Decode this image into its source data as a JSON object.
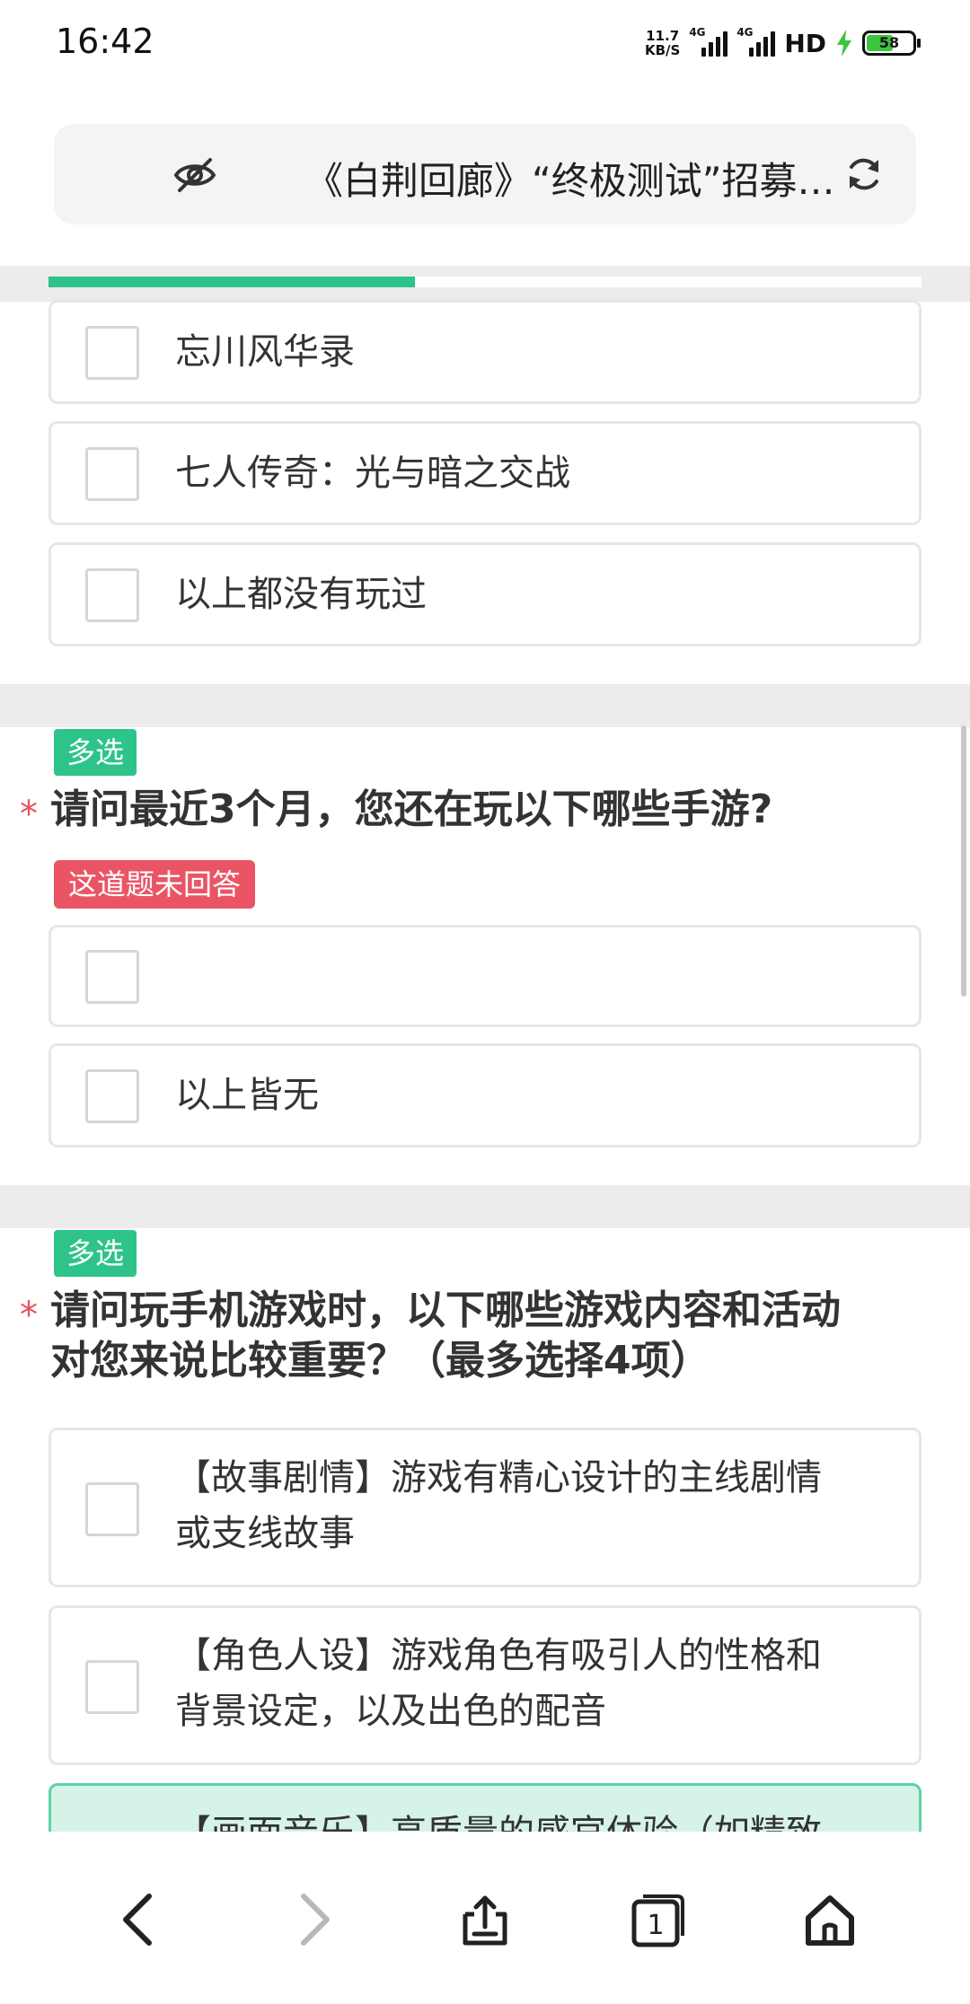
{
  "status_bar": {
    "time": "16:42",
    "net_speed_value": "11.7",
    "net_speed_unit": "KB/S",
    "sim1_label": "4G",
    "sim2_label": "4G",
    "hd_label": "HD",
    "battery_level": "58"
  },
  "url_bar": {
    "title": "《白荆回廊》“终极测试”招募…",
    "eye_icon": "eye-off-icon",
    "reload_icon": "reload-icon"
  },
  "progress": {
    "fraction": 0.42
  },
  "question_prev": {
    "options": [
      "忘川风华录",
      "七人传奇：光与暗之交战",
      "以上都没有玩过"
    ]
  },
  "question_games": {
    "tag": "多选",
    "required_mark": "*",
    "title": "请问最近3个月，您还在玩以下哪些手游?",
    "warning": "这道题未回答",
    "options": [
      "",
      "以上皆无"
    ]
  },
  "question_content": {
    "tag": "多选",
    "required_mark": "*",
    "title_line1": "请问玩手机游戏时，以下哪些游戏内容和活动",
    "title_line2": "对您来说比较重要？（最多选择4项）",
    "options": [
      {
        "line1": "【故事剧情】游戏有精心设计的主线剧情",
        "line2": "或支线故事"
      },
      {
        "line1": "【角色人设】游戏角色有吸引人的性格和",
        "line2": "背景设定，以及出色的配音"
      },
      {
        "line1": "【画面音乐】高质量的感官体验（如精致"
      }
    ]
  },
  "colors": {
    "accent": "#2ec489",
    "warning": "#ea5565",
    "required": "#e94f5b",
    "highlight_bg": "#d6f3e8"
  },
  "bottom_nav": {
    "icons": [
      "back-icon",
      "forward-icon",
      "share-icon",
      "tabs-icon",
      "home-icon"
    ],
    "tab_count": "1"
  }
}
